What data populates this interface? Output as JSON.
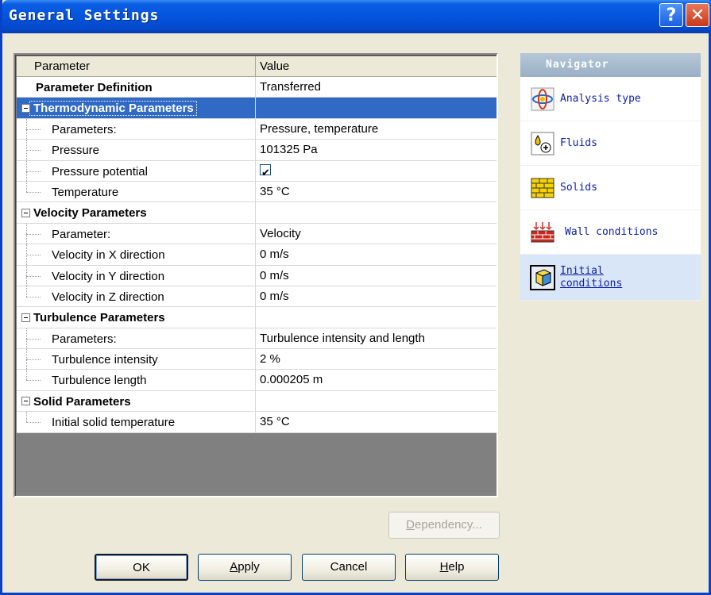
{
  "window": {
    "title": "General Settings",
    "help_glyph": "?",
    "close_glyph": "✕"
  },
  "grid": {
    "header": {
      "parameter": "Parameter",
      "value": "Value"
    },
    "top_row": {
      "label": "Parameter Definition",
      "value": "Transferred"
    },
    "groups": [
      {
        "label": "Thermodynamic Parameters",
        "selected": true,
        "children": [
          {
            "label": "Parameters:",
            "value": "Pressure, temperature"
          },
          {
            "label": "Pressure",
            "value": "101325 Pa"
          },
          {
            "label": "Pressure potential",
            "value": "",
            "checkbox": true
          },
          {
            "label": "Temperature",
            "value": "35 °C"
          }
        ]
      },
      {
        "label": "Velocity Parameters",
        "children": [
          {
            "label": "Parameter:",
            "value": "Velocity"
          },
          {
            "label": "Velocity in X direction",
            "value": "0 m/s"
          },
          {
            "label": "Velocity in Y direction",
            "value": "0 m/s"
          },
          {
            "label": "Velocity in Z direction",
            "value": "0 m/s"
          }
        ]
      },
      {
        "label": "Turbulence Parameters",
        "children": [
          {
            "label": "Parameters:",
            "value": "Turbulence intensity and length"
          },
          {
            "label": "Turbulence intensity",
            "value": "2 %"
          },
          {
            "label": "Turbulence length",
            "value": "0.000205 m"
          }
        ]
      },
      {
        "label": "Solid Parameters",
        "children": [
          {
            "label": "Initial solid temperature",
            "value": "35 °C"
          }
        ]
      }
    ]
  },
  "navigator": {
    "title": "Navigator",
    "items": [
      {
        "label": "Analysis type",
        "icon": "analysis-type-icon"
      },
      {
        "label": "Fluids",
        "icon": "fluids-icon"
      },
      {
        "label": "Solids",
        "icon": "solids-icon"
      },
      {
        "label": "Wall conditions",
        "icon": "wall-conditions-icon"
      },
      {
        "label_line1": "Initial",
        "label_line2": "conditions",
        "icon": "initial-conditions-icon",
        "active": true
      }
    ]
  },
  "buttons": {
    "dependency": "Dependency...",
    "ok": "OK",
    "apply_mnemonic": "A",
    "apply_rest": "pply",
    "cancel": "Cancel",
    "help_mnemonic": "H",
    "help_rest": "elp",
    "dependency_mnemonic": "D",
    "dependency_rest": "ependency..."
  },
  "colors": {
    "titlebar": "#0454dd",
    "selection": "#316ac5",
    "link": "#0b1ea8"
  }
}
